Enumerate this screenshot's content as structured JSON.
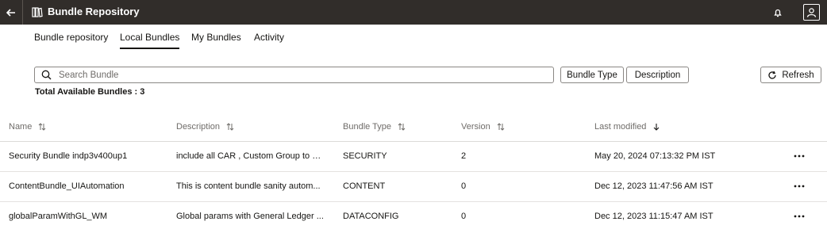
{
  "header": {
    "title": "Bundle Repository",
    "back_icon": "back-arrow-icon",
    "app_icon": "library-icon",
    "notification_icon": "bell-icon",
    "user_icon": "user-avatar-icon",
    "background": "#312d2a"
  },
  "tabs": [
    {
      "label": "Bundle repository",
      "active": false
    },
    {
      "label": "Local Bundles",
      "active": true
    },
    {
      "label": "My Bundles",
      "active": false
    },
    {
      "label": "Activity",
      "active": false
    }
  ],
  "search": {
    "placeholder": "Search Bundle",
    "value": ""
  },
  "filters": {
    "bundle_type": "Bundle Type",
    "description": "Description"
  },
  "refresh_label": "Refresh",
  "total_text": "Total Available Bundles : 3",
  "table": {
    "columns": [
      {
        "label": "Name",
        "sort": "unsorted"
      },
      {
        "label": "Description",
        "sort": "unsorted"
      },
      {
        "label": "Bundle Type",
        "sort": "unsorted"
      },
      {
        "label": "Version",
        "sort": "unsorted"
      },
      {
        "label": "Last modified",
        "sort": "descending"
      }
    ],
    "rows": [
      {
        "name": "Security Bundle indp3v400up1",
        "description": "include all CAR , Custom Group to R...",
        "type": "SECURITY",
        "version": "2",
        "modified": "May 20, 2024 07:13:32 PM IST"
      },
      {
        "name": "ContentBundle_UIAutomation",
        "description": "This is content bundle sanity autom...",
        "type": "CONTENT",
        "version": "0",
        "modified": "Dec 12, 2023 11:47:56 AM IST"
      },
      {
        "name": "globalParamWithGL_WM",
        "description": "Global params with General Ledger ...",
        "type": "DATACONFIG",
        "version": "0",
        "modified": "Dec 12, 2023 11:15:47 AM IST"
      }
    ]
  }
}
